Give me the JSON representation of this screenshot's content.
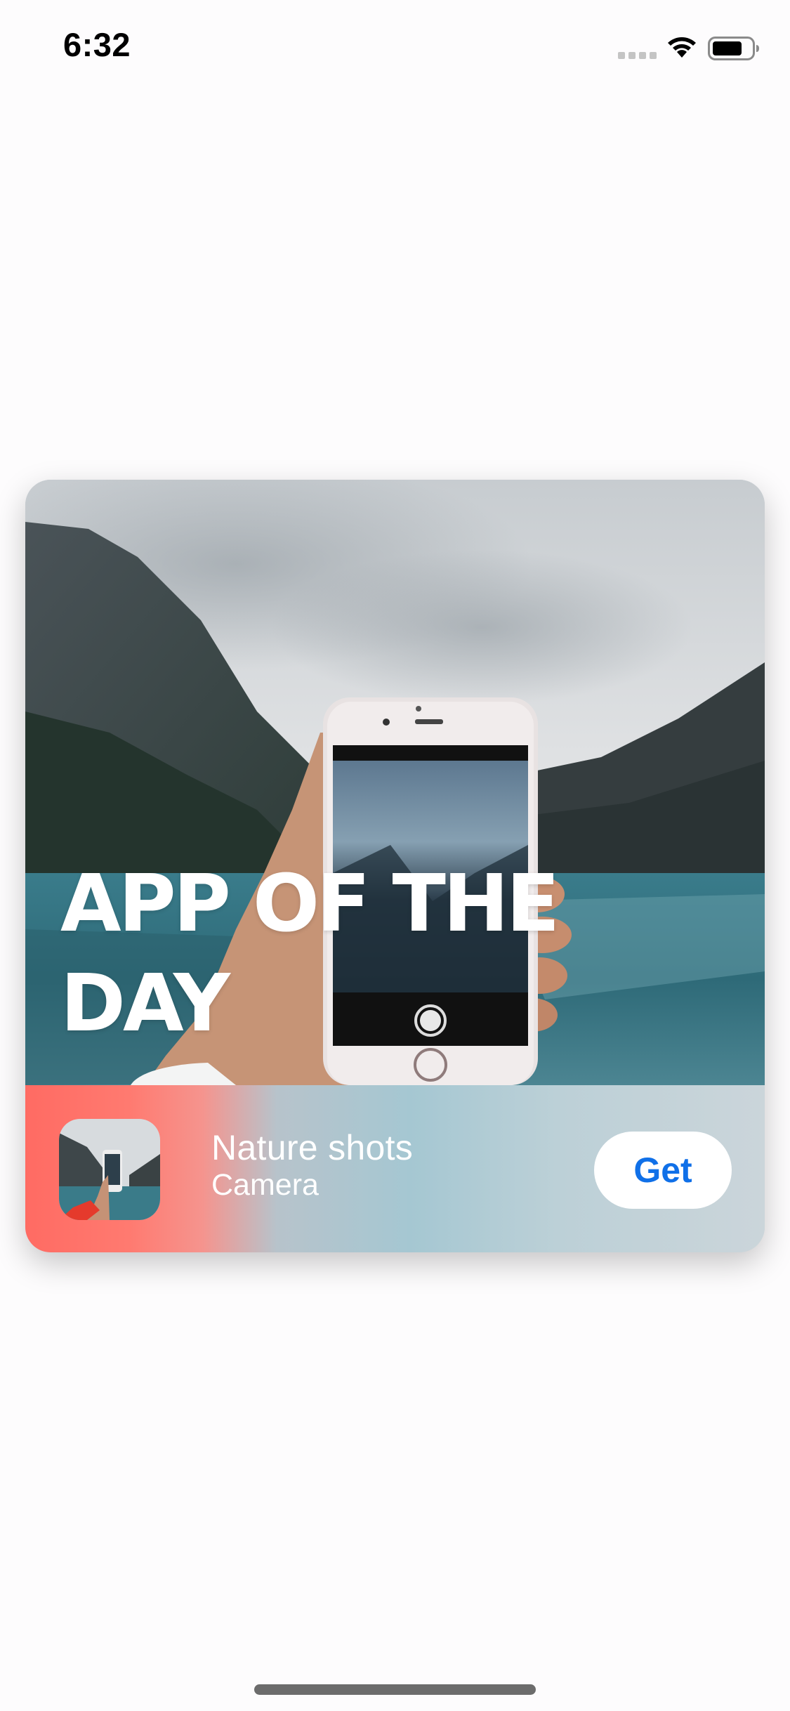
{
  "status_bar": {
    "time": "6:32",
    "icons": [
      "cellular-signal-icon",
      "wifi-icon",
      "battery-icon"
    ]
  },
  "card": {
    "title": "APP OF THE DAY",
    "hero_image": "hand-holding-phone-photographing-mountain-lake",
    "app": {
      "icon": "nature-shots-app-icon",
      "name": "Nature shots",
      "category": "Camera",
      "get_label": "Get"
    }
  },
  "colors": {
    "accent": "#1070e8",
    "gradient_start": "#ff6b63",
    "gradient_end": "#cbd5da",
    "title_text": "#ffffff"
  }
}
